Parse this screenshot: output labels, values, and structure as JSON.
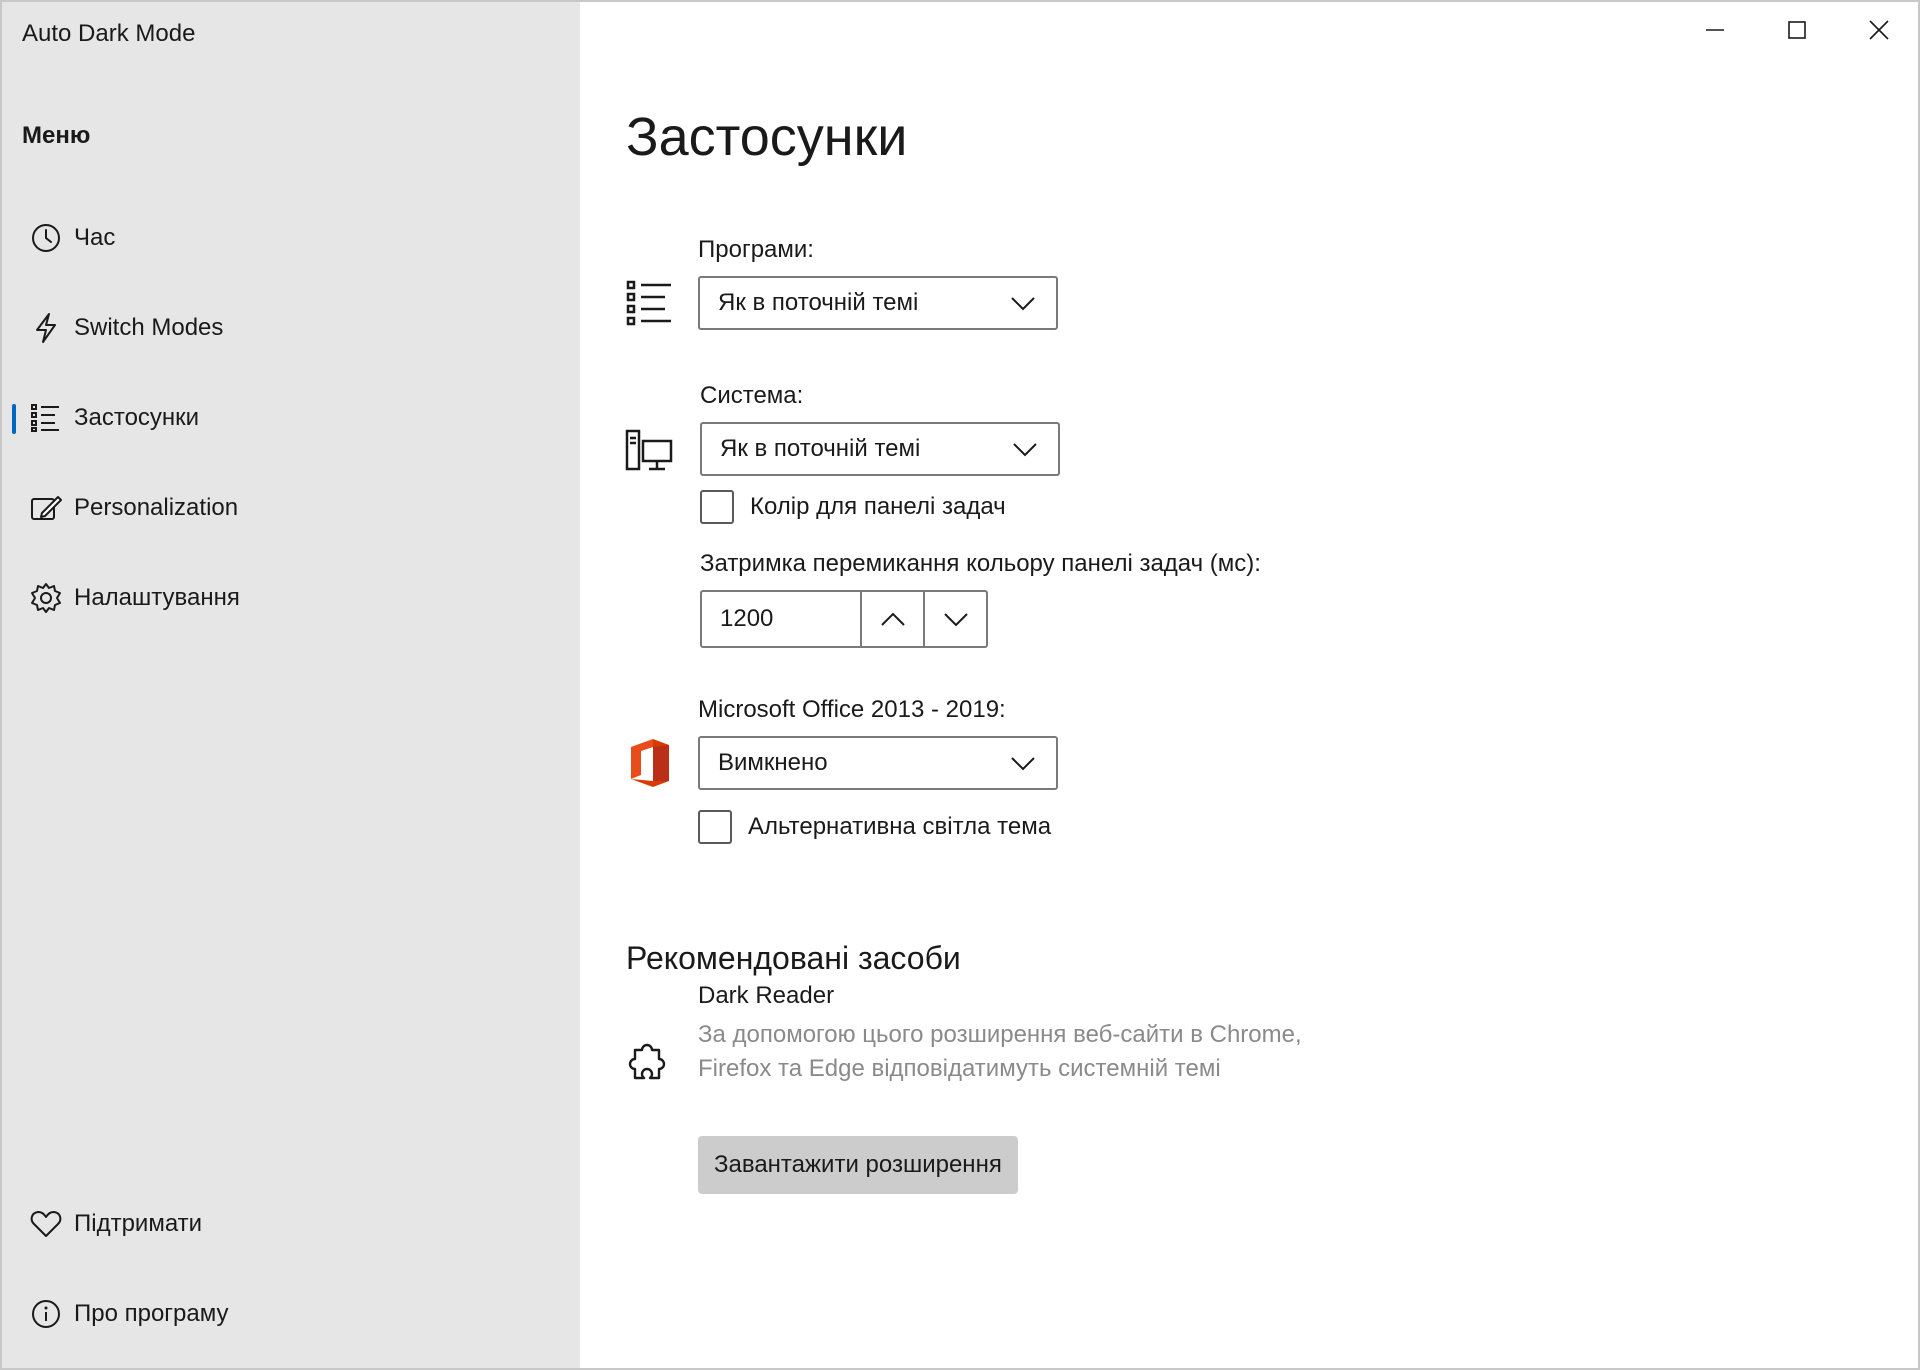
{
  "window": {
    "title": "Auto Dark Mode",
    "controls": {
      "minimize": "minimize",
      "maximize": "maximize",
      "close": "close"
    }
  },
  "sidebar": {
    "header": "Меню",
    "items": [
      {
        "label": "Час",
        "icon": "clock-icon"
      },
      {
        "label": "Switch Modes",
        "icon": "lightning-icon"
      },
      {
        "label": "Застосунки",
        "icon": "list-icon",
        "selected": true
      },
      {
        "label": "Personalization",
        "icon": "personalize-icon"
      },
      {
        "label": "Налаштування",
        "icon": "gear-icon"
      }
    ],
    "footer_items": [
      {
        "label": "Підтримати",
        "icon": "heart-icon"
      },
      {
        "label": "Про програму",
        "icon": "info-icon"
      }
    ],
    "accent": "#0067c0"
  },
  "main": {
    "title": "Застосунки",
    "apps": {
      "label": "Програми:",
      "value": "Як в поточній темі"
    },
    "system": {
      "label": "Система:",
      "value": "Як в поточній темі",
      "taskbar_checkbox": "Колір для панелі задач",
      "taskbar_checkbox_checked": false,
      "delay_label": "Затримка перемикання кольору панелі задач (мс):",
      "delay_value": "1200"
    },
    "office": {
      "label": "Microsoft Office 2013 - 2019:",
      "value": "Вимкнено",
      "alt_checkbox": "Альтернативна світла тема",
      "alt_checkbox_checked": false
    },
    "recommended": {
      "title": "Рекомендовані засоби",
      "name": "Dark Reader",
      "description": "За допомогою цього розширення веб-сайти в Chrome, Firefox та Edge відповідатимуть системній темі",
      "button": "Завантажити розширення"
    }
  }
}
